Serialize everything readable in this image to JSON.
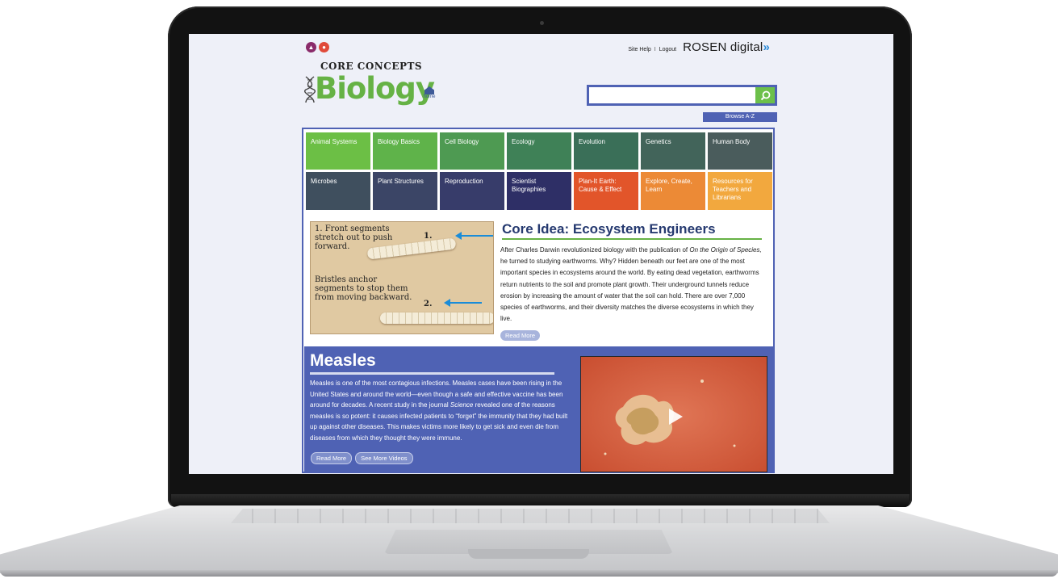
{
  "header": {
    "brand_line": "CORE CONCEPTS",
    "brand_title": "Biology",
    "home_label": "home",
    "site_help": "Site Help",
    "separator": "I",
    "logout": "Logout",
    "rosen": "ROSEN",
    "digital": "digital",
    "rosen_chev": "»"
  },
  "search": {
    "value": "",
    "placeholder": "",
    "browse_label": "Browse A-Z"
  },
  "nav": {
    "items": [
      {
        "label": "Animal Systems",
        "color": "#6cbf45"
      },
      {
        "label": "Biology Basics",
        "color": "#5fb34a"
      },
      {
        "label": "Cell Biology",
        "color": "#4e9a52"
      },
      {
        "label": "Ecology",
        "color": "#3f8157"
      },
      {
        "label": "Evolution",
        "color": "#3a6f58"
      },
      {
        "label": "Genetics",
        "color": "#42645a"
      },
      {
        "label": "Human Body",
        "color": "#4a5c5c"
      },
      {
        "label": "Microbes",
        "color": "#3f4f5e"
      },
      {
        "label": "Plant Structures",
        "color": "#3b4566"
      },
      {
        "label": "Reproduction",
        "color": "#373c6a"
      },
      {
        "label": "Scientist Biographies",
        "color": "#2e2f66"
      },
      {
        "label": "Plan-It Earth: Cause & Effect",
        "color": "#e2552a"
      },
      {
        "label": "Explore, Create, Learn",
        "color": "#ec8a36"
      },
      {
        "label": "Resources for Teachers and Librarians",
        "color": "#f2a83e"
      }
    ]
  },
  "core_idea": {
    "title": "Core Idea: Ecosystem Engineers",
    "body_pre": "After Charles Darwin revolutionized biology with the publication of ",
    "body_book": "On the Origin of Species,",
    "body_post": " he turned to studying earthworms. Why? Hidden beneath our feet are one of the most important species in ecosystems around the world. By eating dead vegetation, earthworms return nutrients to the soil and promote plant growth. Their underground tunnels reduce erosion by increasing the amount of water that the soil can hold. There are over 7,000 species of earthworms, and their diversity matches the diverse ecosystems in which they live.",
    "read_more": "Read More",
    "figure": {
      "label1": "1. Front segments stretch out to push forward.",
      "label2": "Bristles anchor segments to stop them from moving backward.",
      "num1": "1.",
      "num2": "2."
    }
  },
  "measles": {
    "title": "Measles",
    "body_pre": "Measles is one of the most contagious infections. Measles cases have been rising in the United States and around the world—even though a safe and effective vaccine has been around for decades. A recent study in the journal ",
    "body_journal": "Science",
    "body_post": " revealed one of the reasons measles is so potent: it causes infected patients to “forget” the immunity that they had built up against other diseases. This makes victims more likely to get sick and even die from diseases from which they thought they were immune.",
    "read_more": "Read More",
    "see_more_videos": "See More Videos"
  },
  "colors": {
    "accent_blue": "#4f62b4",
    "brand_green": "#66b245",
    "title_navy": "#263a70"
  },
  "icons": [
    "brand-a-icon",
    "brand-b-icon",
    "dna-icon",
    "home-icon",
    "search-icon",
    "play-icon"
  ]
}
